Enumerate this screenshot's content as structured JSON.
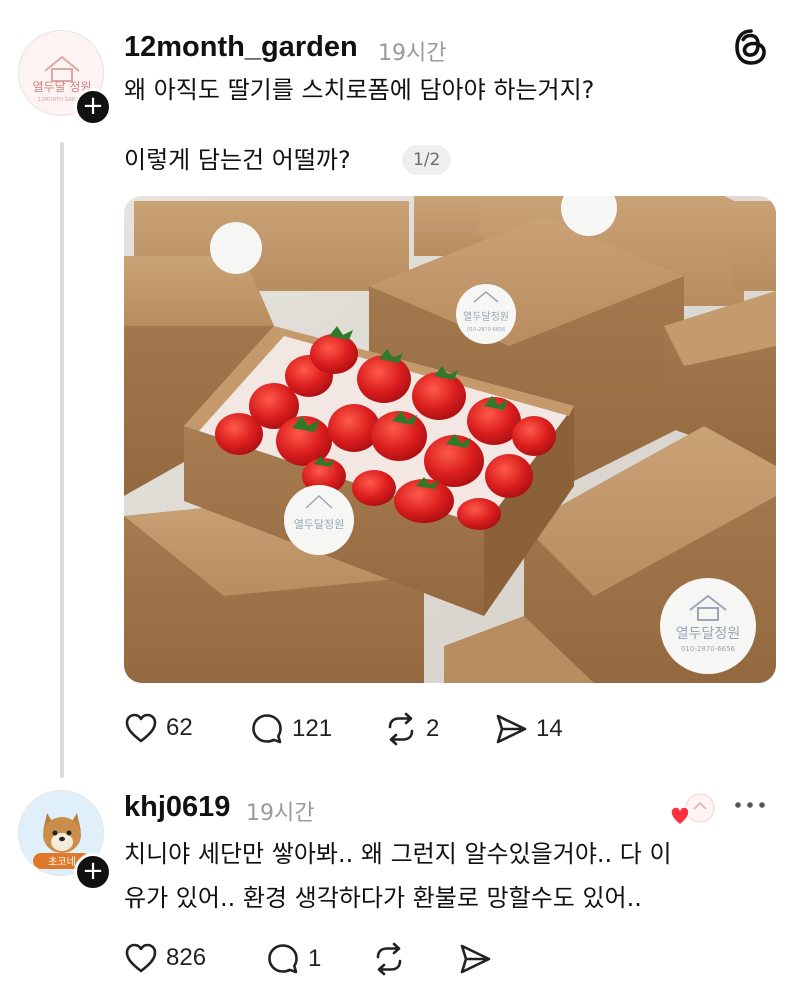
{
  "app": {
    "logo_icon": "threads-logo-icon"
  },
  "post": {
    "author": {
      "username": "12month_garden",
      "avatar_text": "열두달 정원",
      "avatar_subtext": "12MONTH GARDEN"
    },
    "time": "19시간",
    "text_line1": "왜 아직도 딸기를 스치로폼에 담아야 하는거지?",
    "text_line2": "이렇게 담는건 어떨까?",
    "page_indicator": "1/2",
    "image_label": "열두달정원",
    "image_phone": "010-2870-6656",
    "actions": {
      "like_count": "62",
      "reply_count": "121",
      "repost_count": "2",
      "share_count": "14"
    }
  },
  "reply": {
    "author": {
      "username": "khj0619",
      "avatar_text": "초코네"
    },
    "time": "19시간",
    "text_line1": "치니야 세단만 쌓아봐.. 왜 그런지 알수있을거야.. 다 이",
    "text_line2": "유가 있어.. 환경 생각하다가 환불로 망할수도 있어..",
    "actions": {
      "like_count": "826",
      "reply_count": "1"
    }
  },
  "colors": {
    "text": "#111111",
    "muted": "#9a9a9a",
    "heart_red": "#ff3040",
    "kraft": "#c49a6c"
  }
}
